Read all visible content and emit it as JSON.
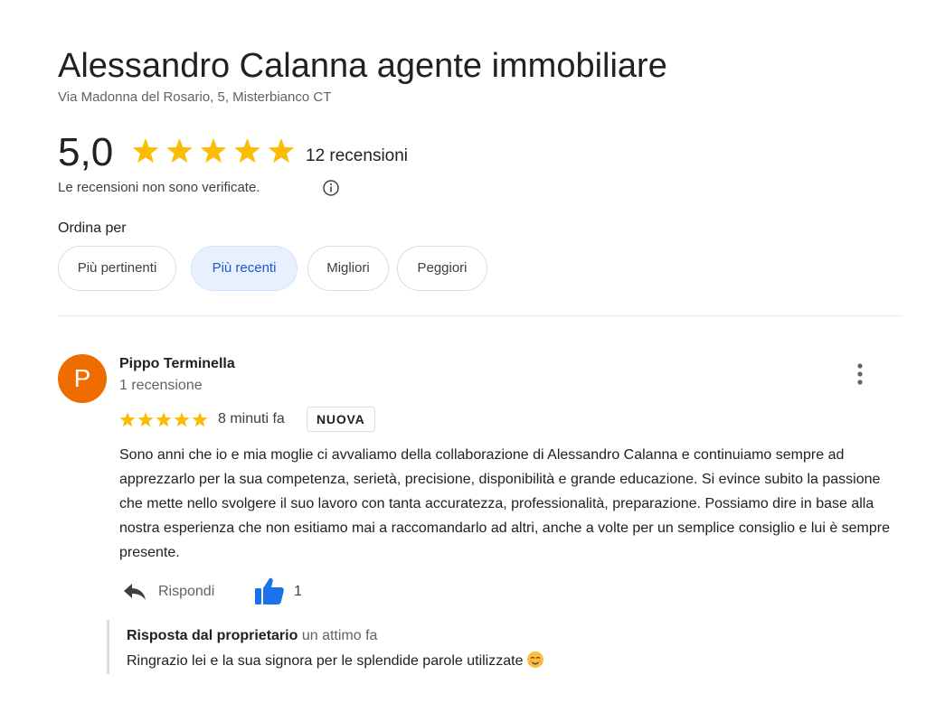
{
  "business": {
    "name": "Alessandro Calanna agente immobiliare",
    "address": "Via Madonna del Rosario, 5, Misterbianco CT"
  },
  "rating": {
    "value": "5,0",
    "stars": 5,
    "review_count": "12 recensioni",
    "unverified_note": "Le recensioni non sono verificate."
  },
  "sort": {
    "label": "Ordina per",
    "options": [
      "Più pertinenti",
      "Più recenti",
      "Migliori",
      "Peggiori"
    ],
    "selected": "Più recenti"
  },
  "review": {
    "avatar_letter": "P",
    "reviewer": "Pippo Terminella",
    "reviewer_meta": "1 recensione",
    "stars": 5,
    "time": "8 minuti fa",
    "badge": "NUOVA",
    "text": "Sono anni che io e mia moglie ci avvaliamo della collaborazione di Alessandro Calanna e continuiamo sempre ad apprezzarlo per la sua competenza, serietà, precisione, disponibilità e grande educazione. Si evince subito la passione che mette nello svolgere il suo lavoro con tanta accuratezza, professionalità, preparazione. Possiamo dire in base alla nostra esperienza che non esitiamo mai a raccomandarlo ad altri, anche a volte per un semplice consiglio e lui è sempre presente.",
    "reply_label": "Rispondi",
    "like_count": "1",
    "owner_reply": {
      "title": "Risposta dal proprietario",
      "time": "un attimo fa",
      "text": "Ringrazio lei e la sua signora per le splendide parole utilizzate"
    }
  },
  "colors": {
    "star": "#fbbc04",
    "accent_blue": "#1a73e8",
    "avatar": "#ef6c00",
    "chip_active_bg": "#e8f0fe"
  },
  "icons": [
    "star-icon",
    "info-icon",
    "more-vert-icon",
    "reply-icon",
    "thumb-up-icon",
    "smiling-face-emoji"
  ]
}
